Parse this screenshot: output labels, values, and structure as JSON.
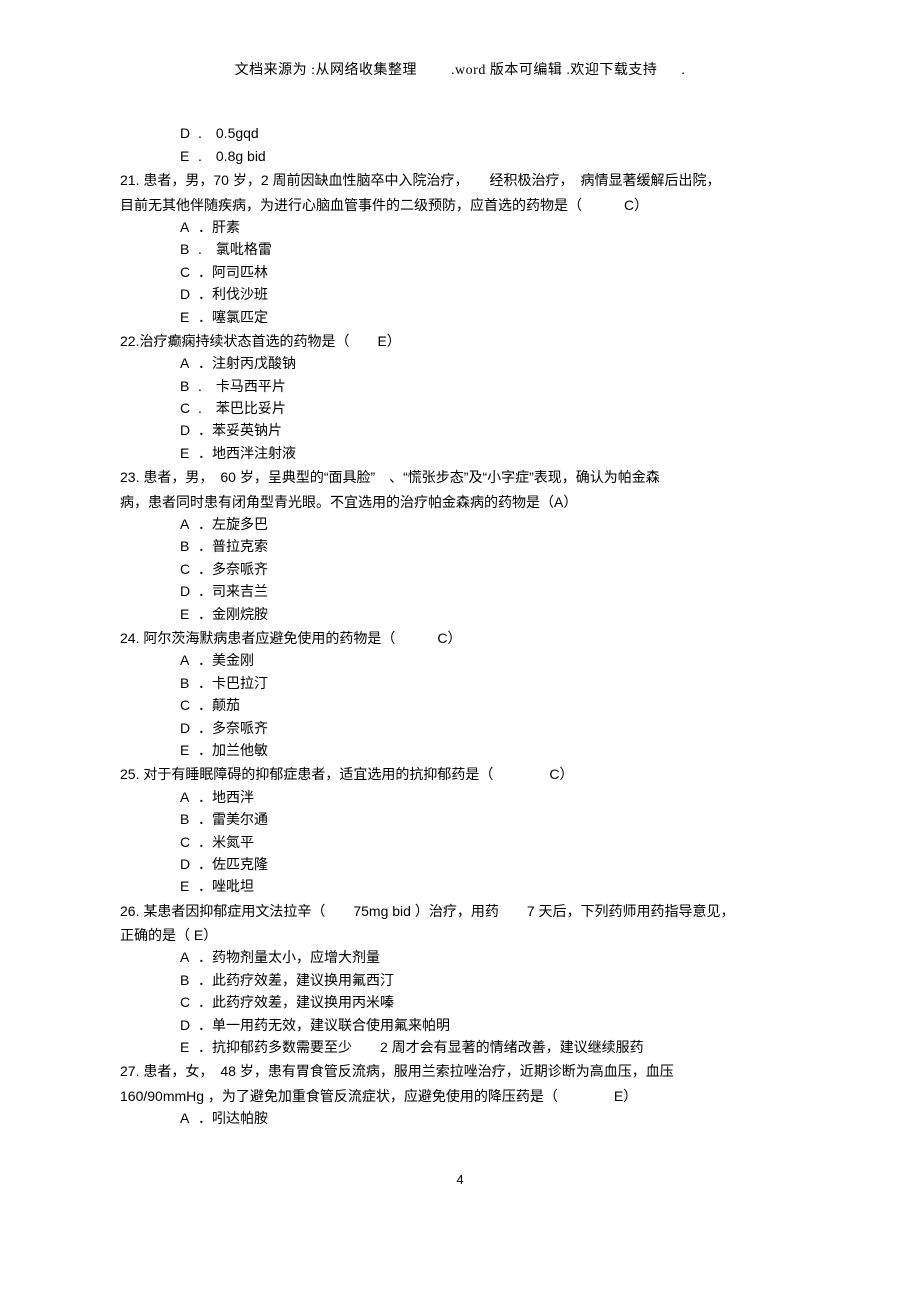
{
  "header": {
    "part1": "文档来源为 :从网络收集整理",
    "part2": ".word 版本可编辑 .欢迎下载支持",
    "part3": "."
  },
  "q20_options": {
    "D": "0.5gqd",
    "E": "0.8g bid"
  },
  "q21": {
    "line1": "21. 患者，男，70 岁，2 周前因缺血性脑卒中入院治疗，　　经积极治疗，　病情显著缓解后出院，",
    "line2": "目前无其他伴随疾病，为进行心脑血管事件的二级预防，应首选的药物是（　　　C）",
    "A": "肝素",
    "B": "氯吡格雷",
    "C": "阿司匹林",
    "D": "利伐沙班",
    "E": "噻氯匹定"
  },
  "q22": {
    "stem": "22.治疗癫痫持续状态首选的药物是（　　E）",
    "A": "注射丙戊酸钠",
    "B": "卡马西平片",
    "C": "苯巴比妥片",
    "D": "苯妥英钠片",
    "E": "地西泮注射液"
  },
  "q23": {
    "line1": "23. 患者，男，　60 岁，呈典型的“面具脸”　、“慌张步态”及“小字症”表现，确认为帕金森",
    "line2": "病，患者同时患有闭角型青光眼。不宜选用的治疗帕金森病的药物是（A）",
    "A": "左旋多巴",
    "B": "普拉克索",
    "C": "多奈哌齐",
    "D": "司来吉兰",
    "E": "金刚烷胺"
  },
  "q24": {
    "stem": "24. 阿尔茨海默病患者应避免使用的药物是（　　　C）",
    "A": "美金刚",
    "B": "卡巴拉汀",
    "C": "颠茄",
    "D": "多奈哌齐",
    "E": "加兰他敏"
  },
  "q25": {
    "stem": "25. 对于有睡眠障碍的抑郁症患者，适宜选用的抗抑郁药是（　　　　C）",
    "A": "地西泮",
    "B": "雷美尔通",
    "C": "米氮平",
    "D": "佐匹克隆",
    "E": "唑吡坦"
  },
  "q26": {
    "line1": "26. 某患者因抑郁症用文法拉辛（　　75mg bid ）治疗，用药　　7 天后，下列药师用药指导意见，",
    "line2": "正确的是（ E）",
    "A": "药物剂量太小，应增大剂量",
    "B": "此药疗效差，建议换用氟西汀",
    "C": "此药疗效差，建议换用丙米嗪",
    "D": "单一用药无效，建议联合使用氟来帕明",
    "E": "抗抑郁药多数需要至少　　2 周才会有显著的情绪改善，建议继续服药"
  },
  "q27": {
    "line1": "27. 患者，女，　48 岁，患有胃食管反流病，服用兰索拉唑治疗，近期诊断为高血压，血压",
    "line2": "160/90mmHg ，为了避免加重食管反流症状，应避免使用的降压药是（　　　　E）",
    "A": "吲达帕胺"
  },
  "footer": {
    "page": "4"
  }
}
